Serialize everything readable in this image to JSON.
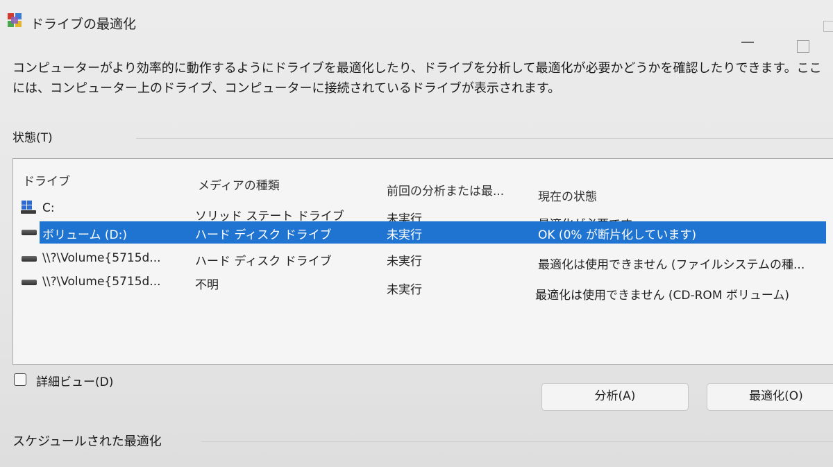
{
  "window": {
    "title": "ドライブの最適化"
  },
  "description": "コンピューターがより効率的に動作するようにドライブを最適化したり、ドライブを分析して最適化が必要かどうかを確認したりできます。ここ\nには、コンピューター上のドライブ、コンピューターに接続されているドライブが表示されます。",
  "status": {
    "label": "状態(T)"
  },
  "drives": {
    "columns": [
      "ドライブ",
      "メディアの種類",
      "前回の分析または最...",
      "現在の状態"
    ],
    "rows": [
      {
        "drive": "C:",
        "media": "ソリッド ステート ドライブ",
        "last": "未実行",
        "state": "最適化が必要です",
        "icon": "os-drive-icon"
      },
      {
        "drive": "ボリューム (D:)",
        "media": "ハード ディスク ドライブ",
        "last": "未実行",
        "state": "OK (0% が断片化しています)",
        "icon": "hard-drive-icon",
        "selected": true
      },
      {
        "drive": "\\\\?\\Volume{5715d...",
        "media": "ハード ディスク ドライブ",
        "last": "未実行",
        "state": "最適化は使用できません (ファイルシステムの種...",
        "icon": "hard-drive-icon"
      },
      {
        "drive": "\\\\?\\Volume{5715d...",
        "media": "不明",
        "last": "未実行",
        "state": "最適化は使用できません (CD-ROM ボリューム)",
        "icon": "hard-drive-icon"
      }
    ]
  },
  "detail_view": {
    "label": "詳細ビュー(D)",
    "checked": false
  },
  "buttons": {
    "analyze": "分析(A)",
    "optimize": "最適化(O)"
  },
  "schedule": {
    "label": "スケジュールされた最適化"
  },
  "colors": {
    "selection": "#1f74d1",
    "background": "#e9e9e9"
  }
}
